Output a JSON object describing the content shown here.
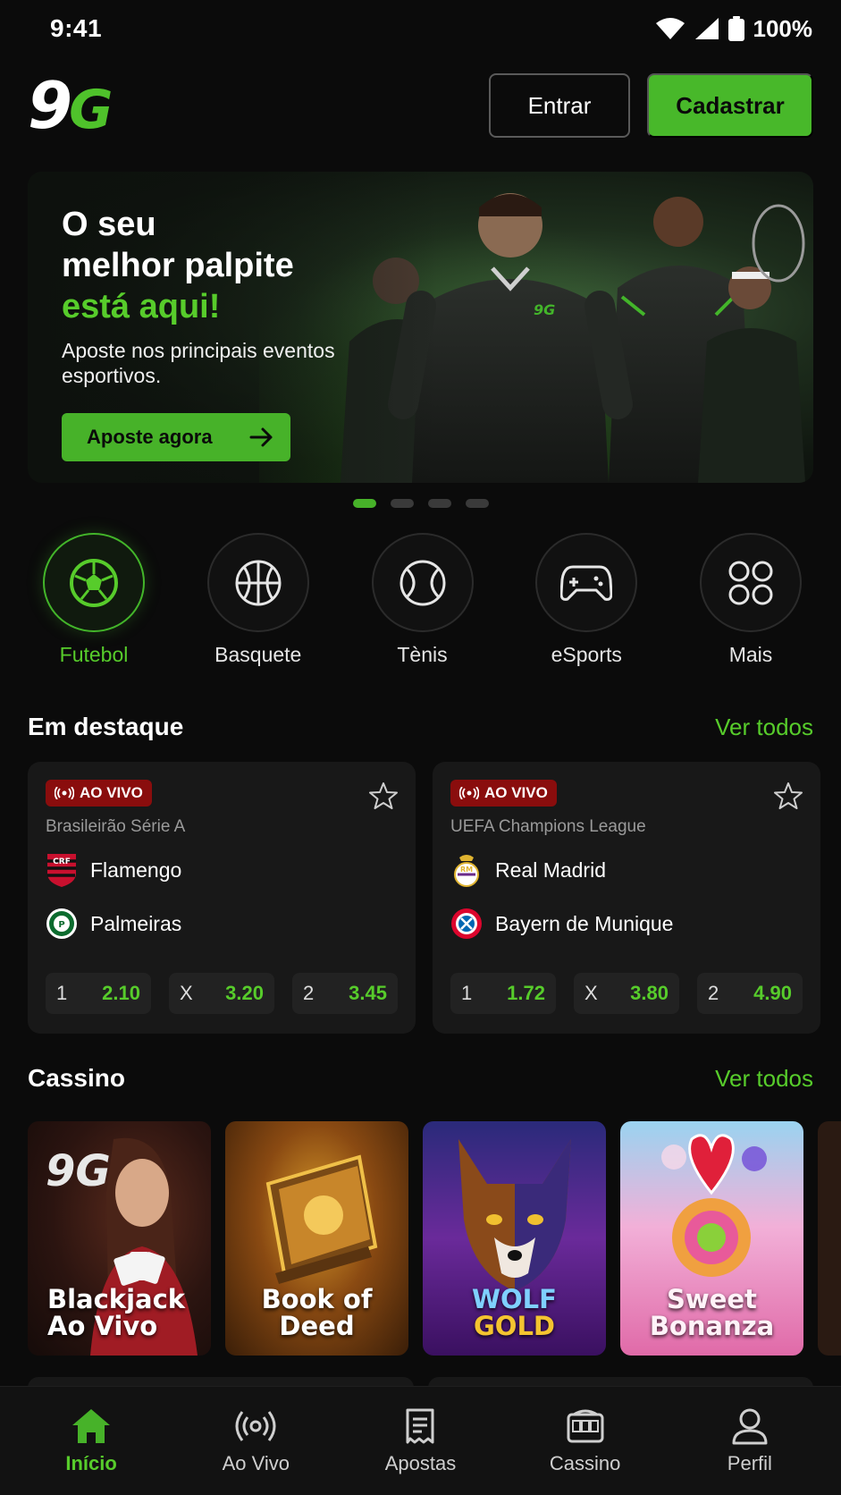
{
  "status": {
    "time": "9:41",
    "battery": "100%"
  },
  "header": {
    "logo_main": "9",
    "logo_accent": "G",
    "login_label": "Entrar",
    "register_label": "Cadastrar"
  },
  "banner": {
    "title_line1": "O seu",
    "title_line2": "melhor palpite",
    "title_highlight": "está aqui!",
    "subtitle": "Aposte nos principais eventos esportivos.",
    "cta_label": "Aposte agora",
    "slide_count": 4,
    "active_slide": 1
  },
  "sports": [
    {
      "label": "Futebol",
      "icon": "soccer-ball-icon",
      "active": true
    },
    {
      "label": "Basquete",
      "icon": "basketball-icon",
      "active": false
    },
    {
      "label": "Tènis",
      "icon": "tennis-ball-icon",
      "active": false
    },
    {
      "label": "eSports",
      "icon": "gamepad-icon",
      "active": false
    },
    {
      "label": "Mais",
      "icon": "grid-icon",
      "active": false
    }
  ],
  "featured": {
    "title": "Em destaque",
    "link": "Ver todos",
    "matches": [
      {
        "badge": "AO VIVO",
        "league": "Brasileirão Série A",
        "home": "Flamengo",
        "away": "Palmeiras",
        "odds": [
          {
            "label": "1",
            "value": "2.10"
          },
          {
            "label": "X",
            "value": "3.20"
          },
          {
            "label": "2",
            "value": "3.45"
          }
        ]
      },
      {
        "badge": "AO VIVO",
        "league": "UEFA Champions League",
        "home": "Real Madrid",
        "away": "Bayern de Munique",
        "odds": [
          {
            "label": "1",
            "value": "1.72"
          },
          {
            "label": "X",
            "value": "3.80"
          },
          {
            "label": "2",
            "value": "4.90"
          }
        ]
      }
    ]
  },
  "casino": {
    "title": "Cassino",
    "link": "Ver todos",
    "games": [
      {
        "line1": "Blackjack",
        "line2": "Ao Vivo",
        "logo": "9G"
      },
      {
        "line1": "Book of",
        "line2": "Deed"
      },
      {
        "line1": "WOLF",
        "line2": "GOLD"
      },
      {
        "line1": "Sweet",
        "line2": "Bonanza"
      }
    ]
  },
  "nav": [
    {
      "label": "Início",
      "icon": "home-icon",
      "active": true
    },
    {
      "label": "Ao Vivo",
      "icon": "live-broadcast-icon",
      "active": false
    },
    {
      "label": "Apostas",
      "icon": "bet-slip-icon",
      "active": false
    },
    {
      "label": "Cassino",
      "icon": "slot-machine-icon",
      "active": false
    },
    {
      "label": "Perfil",
      "icon": "user-icon",
      "active": false
    }
  ],
  "colors": {
    "accent": "#47b229",
    "live": "#8a0d0d",
    "background": "#0b0b0b"
  }
}
